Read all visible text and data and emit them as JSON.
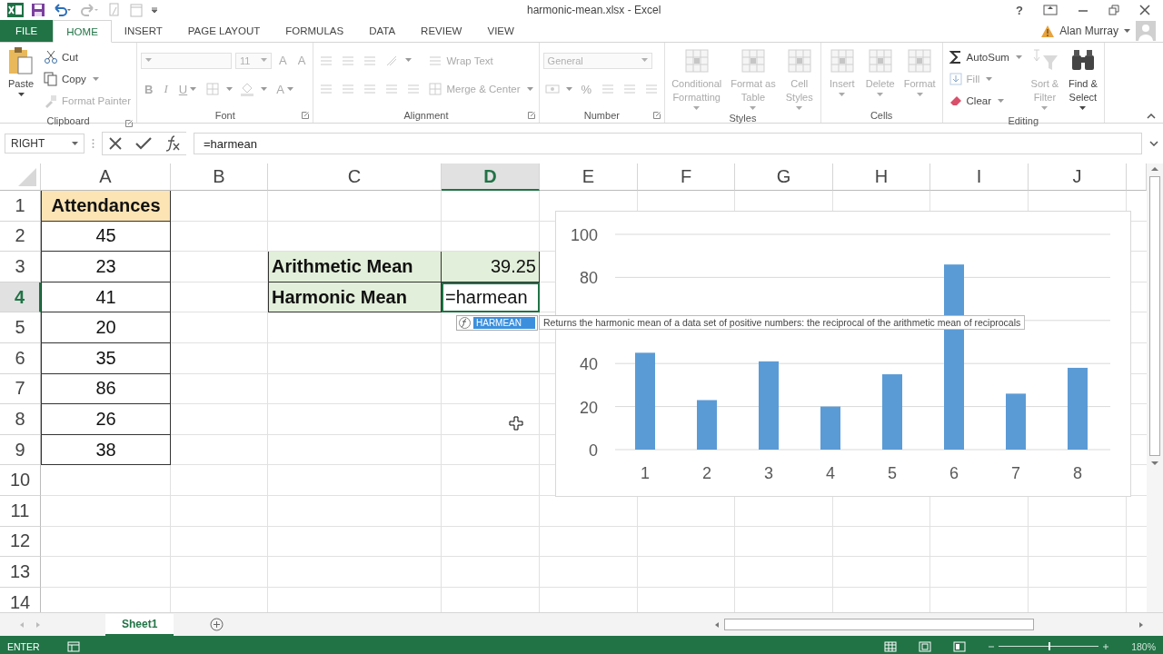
{
  "window": {
    "title": "harmonic-mean.xlsx - Excel",
    "help": "?",
    "user": "Alan Murray"
  },
  "tabs": [
    {
      "label": "FILE",
      "kind": "file",
      "selected": false
    },
    {
      "label": "HOME",
      "kind": "tab",
      "selected": true
    },
    {
      "label": "INSERT",
      "kind": "tab",
      "selected": false
    },
    {
      "label": "PAGE LAYOUT",
      "kind": "tab",
      "selected": false
    },
    {
      "label": "FORMULAS",
      "kind": "tab",
      "selected": false
    },
    {
      "label": "DATA",
      "kind": "tab",
      "selected": false
    },
    {
      "label": "REVIEW",
      "kind": "tab",
      "selected": false
    },
    {
      "label": "VIEW",
      "kind": "tab",
      "selected": false
    }
  ],
  "ribbon": {
    "groups": [
      {
        "label": "Clipboard",
        "launcher": true,
        "parts": [
          {
            "kind": "large",
            "label": "Paste",
            "disabled": false,
            "dropdown": true
          },
          {
            "kind": "stack",
            "rows": [
              {
                "items": [
                  {
                    "kind": "small",
                    "label": "Cut",
                    "disabled": false
                  }
                ]
              },
              {
                "items": [
                  {
                    "kind": "small",
                    "label": "Copy",
                    "disabled": false,
                    "dropdown": true
                  }
                ]
              },
              {
                "items": [
                  {
                    "kind": "small",
                    "label": "Format Painter",
                    "disabled": true
                  }
                ]
              }
            ]
          }
        ]
      },
      {
        "label": "Font",
        "launcher": true,
        "parts": [
          {
            "kind": "stack",
            "rows": [
              {
                "items": [
                  {
                    "kind": "field",
                    "disabled": true
                  },
                  {
                    "kind": "field",
                    "value": "11",
                    "disabled": true
                  },
                  {
                    "kind": "glyph",
                    "label": "A",
                    "disabled": true
                  },
                  {
                    "kind": "glyph",
                    "label": "A",
                    "disabled": true
                  }
                ]
              },
              {
                "items": [
                  {
                    "kind": "glyph",
                    "label": "B",
                    "disabled": true
                  },
                  {
                    "kind": "glyph",
                    "label": "I",
                    "disabled": true
                  },
                  {
                    "kind": "glyph",
                    "label": "U",
                    "disabled": true,
                    "dropdown": true
                  },
                  {
                    "kind": "icon",
                    "disabled": true,
                    "dropdown": true
                  },
                  {
                    "kind": "icon",
                    "disabled": true,
                    "dropdown": true
                  },
                  {
                    "kind": "glyph",
                    "label": "A",
                    "disabled": true,
                    "dropdown": true
                  }
                ]
              }
            ]
          }
        ]
      },
      {
        "label": "Alignment",
        "launcher": true,
        "parts": [
          {
            "kind": "stack",
            "rows": [
              {
                "items": [
                  {
                    "kind": "icon",
                    "disabled": true
                  },
                  {
                    "kind": "icon",
                    "disabled": true
                  },
                  {
                    "kind": "icon",
                    "disabled": true
                  },
                  {
                    "kind": "icon",
                    "disabled": true,
                    "dropdown": true
                  }
                ]
              },
              {
                "items": [
                  {
                    "kind": "icon",
                    "disabled": true
                  },
                  {
                    "kind": "icon",
                    "disabled": true
                  },
                  {
                    "kind": "icon",
                    "disabled": true
                  },
                  {
                    "kind": "icon",
                    "disabled": true
                  },
                  {
                    "kind": "icon",
                    "disabled": true
                  }
                ]
              }
            ]
          },
          {
            "kind": "stack",
            "rows": [
              {
                "items": [
                  {
                    "kind": "small",
                    "label": "Wrap Text",
                    "disabled": true
                  }
                ]
              },
              {
                "items": [
                  {
                    "kind": "small",
                    "label": "Merge & Center",
                    "disabled": true,
                    "dropdown": true
                  }
                ]
              }
            ]
          }
        ]
      },
      {
        "label": "Number",
        "launcher": true,
        "parts": [
          {
            "kind": "stack",
            "rows": [
              {
                "items": [
                  {
                    "kind": "field",
                    "value": "General",
                    "disabled": true
                  }
                ]
              },
              {
                "items": [
                  {
                    "kind": "icon",
                    "disabled": true,
                    "dropdown": true
                  },
                  {
                    "kind": "glyph",
                    "label": "%",
                    "disabled": true
                  },
                  {
                    "kind": "icon",
                    "disabled": true
                  },
                  {
                    "kind": "icon",
                    "disabled": true
                  },
                  {
                    "kind": "icon",
                    "disabled": true
                  }
                ]
              }
            ]
          }
        ]
      },
      {
        "label": "Styles",
        "parts": [
          {
            "kind": "large",
            "label": "Conditional\nFormatting",
            "disabled": true,
            "dropdown": true
          },
          {
            "kind": "large",
            "label": "Format as\nTable",
            "disabled": true,
            "dropdown": true
          },
          {
            "kind": "large",
            "label": "Cell\nStyles",
            "disabled": true,
            "dropdown": true
          }
        ]
      },
      {
        "label": "Cells",
        "parts": [
          {
            "kind": "large",
            "label": "Insert",
            "disabled": true,
            "dropdown": true
          },
          {
            "kind": "large",
            "label": "Delete",
            "disabled": true,
            "dropdown": true
          },
          {
            "kind": "large",
            "label": "Format",
            "disabled": true,
            "dropdown": true
          }
        ]
      },
      {
        "label": "Editing",
        "parts": [
          {
            "kind": "stack",
            "rows": [
              {
                "items": [
                  {
                    "kind": "small",
                    "label": "AutoSum",
                    "disabled": false,
                    "dropdown": true
                  }
                ]
              },
              {
                "items": [
                  {
                    "kind": "small",
                    "label": "Fill",
                    "disabled": true,
                    "dropdown": true
                  }
                ]
              },
              {
                "items": [
                  {
                    "kind": "small",
                    "label": "Clear",
                    "disabled": false,
                    "dropdown": true
                  }
                ]
              }
            ]
          },
          {
            "kind": "large",
            "label": "Sort &\nFilter",
            "disabled": true,
            "dropdown": true
          },
          {
            "kind": "large",
            "label": "Find &\nSelect",
            "disabled": false,
            "dropdown": true
          }
        ]
      }
    ]
  },
  "formula_bar": {
    "name_box": "RIGHT",
    "formula": "=harmean"
  },
  "sheet": {
    "columns": [
      {
        "label": "A",
        "selected": false
      },
      {
        "label": "B",
        "selected": false
      },
      {
        "label": "C",
        "selected": false
      },
      {
        "label": "D",
        "selected": true
      },
      {
        "label": "E",
        "selected": false
      },
      {
        "label": "F",
        "selected": false
      },
      {
        "label": "G",
        "selected": false
      },
      {
        "label": "H",
        "selected": false
      },
      {
        "label": "I",
        "selected": false
      },
      {
        "label": "J",
        "selected": false
      }
    ],
    "rows": [
      {
        "number": "1",
        "selected": false,
        "cells": [
          {
            "text": "Attendances",
            "kind": "header"
          }
        ]
      },
      {
        "number": "2",
        "selected": false,
        "cells": [
          {
            "text": "45",
            "kind": "value"
          }
        ]
      },
      {
        "number": "3",
        "selected": false,
        "cells": [
          {
            "text": "23",
            "kind": "value"
          },
          "",
          {
            "text": "Arithmetic Mean",
            "kind": "label"
          },
          {
            "text": "39.25",
            "kind": "number"
          }
        ]
      },
      {
        "number": "4",
        "selected": true,
        "cells": [
          {
            "text": "41",
            "kind": "value"
          },
          "",
          {
            "text": "Harmonic Mean",
            "kind": "label"
          },
          {
            "text": "=harmean",
            "kind": "editing"
          }
        ]
      },
      {
        "number": "5",
        "selected": false,
        "cells": [
          {
            "text": "20",
            "kind": "value"
          }
        ]
      },
      {
        "number": "6",
        "selected": false,
        "cells": [
          {
            "text": "35",
            "kind": "value"
          }
        ]
      },
      {
        "number": "7",
        "selected": false,
        "cells": [
          {
            "text": "86",
            "kind": "value"
          }
        ]
      },
      {
        "number": "8",
        "selected": false,
        "cells": [
          {
            "text": "26",
            "kind": "value"
          }
        ]
      },
      {
        "number": "9",
        "selected": false,
        "cells": [
          {
            "text": "38",
            "kind": "value"
          }
        ]
      },
      {
        "number": "10",
        "selected": false
      },
      {
        "number": "11",
        "selected": false
      },
      {
        "number": "12",
        "selected": false
      },
      {
        "number": "13",
        "selected": false
      },
      {
        "number": "14",
        "selected": false
      }
    ],
    "autocomplete": {
      "items": [
        {
          "label": "HARMEAN",
          "selected": true
        }
      ],
      "tooltip": "Returns the harmonic mean of a data set of positive numbers: the reciprocal of the arithmetic mean of reciprocals"
    },
    "chart_data": {
      "type": "bar",
      "categories": [
        "1",
        "2",
        "3",
        "4",
        "5",
        "6",
        "7",
        "8"
      ],
      "series": [
        {
          "color": "#5b9bd5",
          "values": [
            45,
            23,
            41,
            20,
            35,
            86,
            26,
            38
          ]
        }
      ],
      "ylim": [
        0,
        100
      ],
      "yticks": [
        0,
        20,
        40,
        80,
        100
      ],
      "grid": true
    }
  },
  "sheet_tabs": [
    {
      "label": "Sheet1",
      "selected": true
    }
  ],
  "status_bar": {
    "mode": "ENTER",
    "zoom": "180%",
    "zoom_slider": {
      "level": 0.5
    }
  }
}
